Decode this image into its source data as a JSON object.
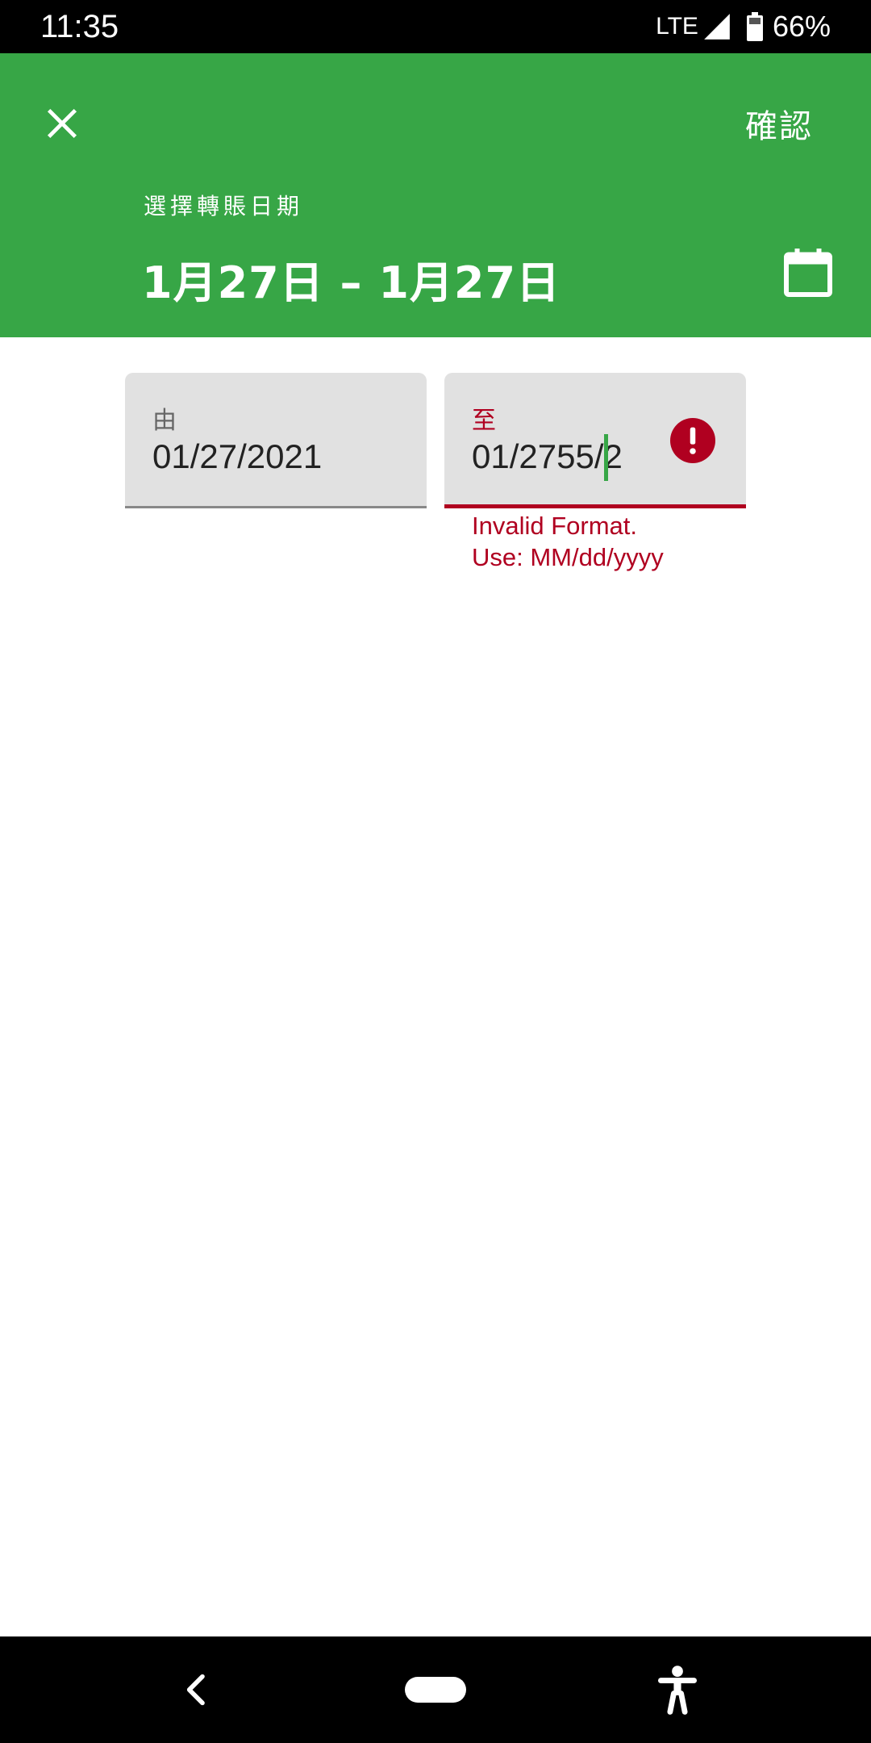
{
  "status_bar": {
    "time": "11:35",
    "network": "LTE",
    "battery": "66%"
  },
  "header": {
    "close_icon": "close-icon",
    "confirm_label": "確認",
    "subtitle": "選擇轉賬日期",
    "range_text": "1月27日 – 1月27日",
    "calendar_icon": "calendar-icon",
    "background_color": "#37a646"
  },
  "fields": {
    "from": {
      "label": "由",
      "value": "01/27/2021"
    },
    "to": {
      "label": "至",
      "value": "01/2755/2",
      "error_icon": "error-icon",
      "error_line1": "Invalid Format.",
      "error_line2": "Use: MM/dd/yyyy",
      "error_color": "#b00020"
    }
  },
  "nav_bar": {
    "back_icon": "back-icon",
    "home_icon": "home-pill-icon",
    "accessibility_icon": "accessibility-icon"
  }
}
